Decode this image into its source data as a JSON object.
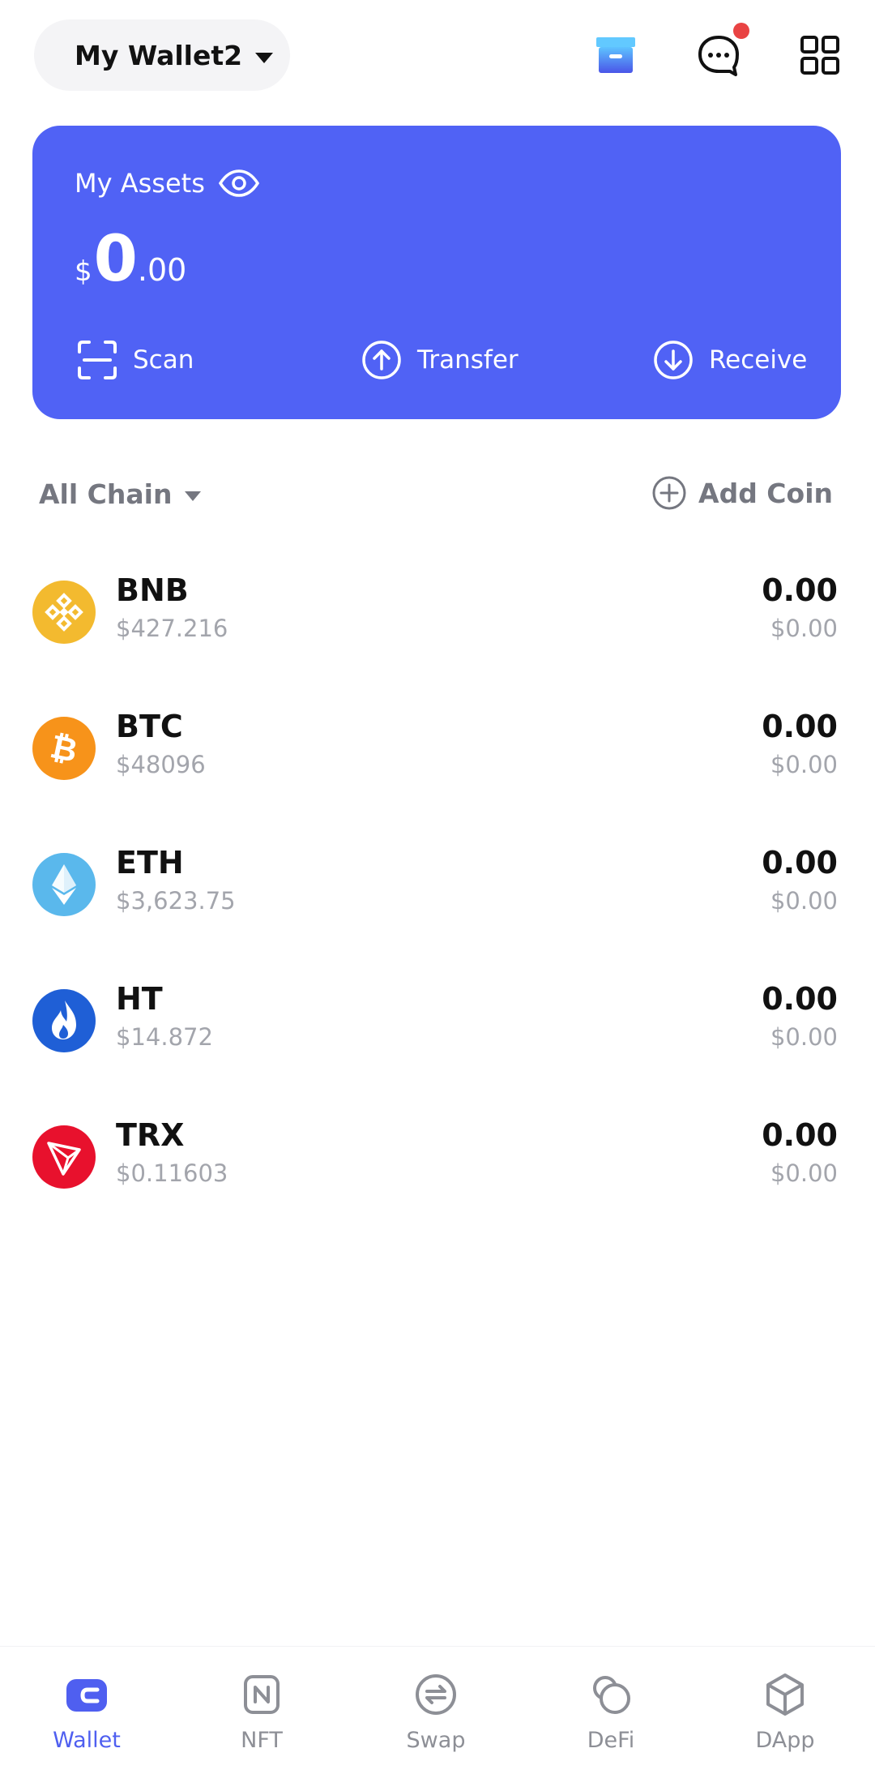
{
  "header": {
    "wallet_name": "My Wallet2",
    "icons": [
      "archive-box-icon",
      "chat-bubble-icon",
      "grid-menu-icon"
    ],
    "chat_has_notification": true
  },
  "assets": {
    "title": "My Assets",
    "currency_symbol": "$",
    "balance_integer": "0",
    "balance_decimal": ".00",
    "actions": [
      {
        "label": "Scan",
        "icon": "scan-icon"
      },
      {
        "label": "Transfer",
        "icon": "arrow-up-circle-icon"
      },
      {
        "label": "Receive",
        "icon": "arrow-down-circle-icon"
      }
    ]
  },
  "chain_filter": {
    "label": "All Chain",
    "add_coin_label": "Add Coin"
  },
  "coins": [
    {
      "symbol": "BNB",
      "price": "$427.216",
      "amount": "0.00",
      "value": "$0.00",
      "color": "#f3ba2f"
    },
    {
      "symbol": "BTC",
      "price": "$48096",
      "amount": "0.00",
      "value": "$0.00",
      "color": "#f7931a"
    },
    {
      "symbol": "ETH",
      "price": "$3,623.75",
      "amount": "0.00",
      "value": "$0.00",
      "color": "#5ab8ec"
    },
    {
      "symbol": "HT",
      "price": "$14.872",
      "amount": "0.00",
      "value": "$0.00",
      "color": "#1f5fd6"
    },
    {
      "symbol": "TRX",
      "price": "$0.11603",
      "amount": "0.00",
      "value": "$0.00",
      "color": "#e8112d"
    }
  ],
  "nav": [
    {
      "label": "Wallet",
      "icon": "wallet-icon",
      "active": true
    },
    {
      "label": "NFT",
      "icon": "nft-icon",
      "active": false
    },
    {
      "label": "Swap",
      "icon": "swap-icon",
      "active": false
    },
    {
      "label": "DeFi",
      "icon": "defi-icon",
      "active": false
    },
    {
      "label": "DApp",
      "icon": "dapp-cube-icon",
      "active": false
    }
  ],
  "colors": {
    "accent": "#5062f5",
    "muted_text": "#a3a5ac",
    "notification": "#e94343"
  }
}
